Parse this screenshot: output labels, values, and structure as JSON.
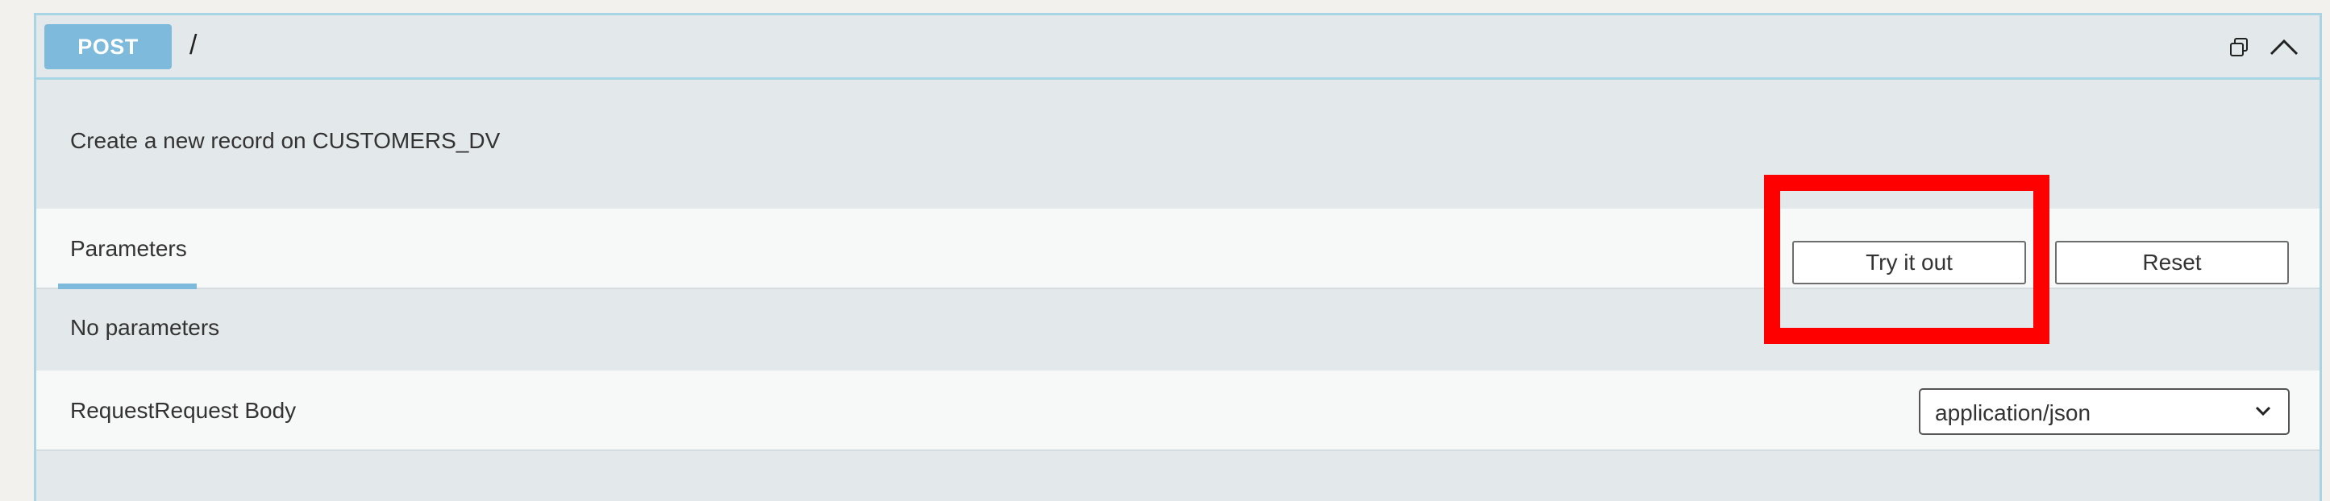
{
  "operation": {
    "method": "POST",
    "path": "/",
    "description": "Create a new record on CUSTOMERS_DV"
  },
  "icons": {
    "copy": "copy-icon",
    "collapse": "chevron-up-icon",
    "dropdown": "chevron-down-icon"
  },
  "parameters": {
    "tab_label": "Parameters",
    "try_label": "Try it out",
    "reset_label": "Reset",
    "empty_text": "No parameters"
  },
  "request_body": {
    "label": "RequestRequest Body",
    "content_type": "application/json"
  },
  "colors": {
    "method_badge": "#7dbadb",
    "border": "#a9d4e4",
    "highlight": "#ff0000"
  }
}
